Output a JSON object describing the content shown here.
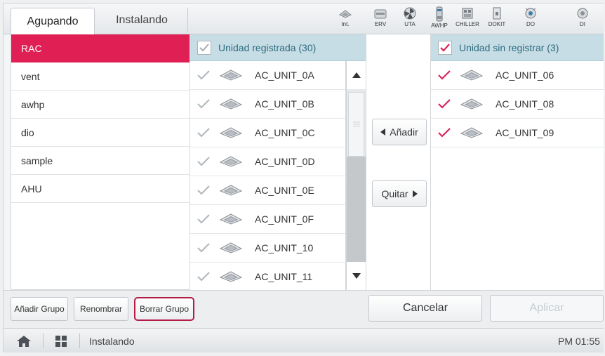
{
  "tabs": [
    {
      "label": "Agupando",
      "active": true
    },
    {
      "label": "Instalando",
      "active": false
    }
  ],
  "toolbar": [
    {
      "label": "Int.",
      "icon": "cassette-unit-icon"
    },
    {
      "label": "ERV",
      "icon": "erv-icon"
    },
    {
      "label": "UTA",
      "icon": "fan-icon"
    },
    {
      "label": "AWHP",
      "icon": "awhp-icon"
    },
    {
      "label": "CHILLER",
      "icon": "chiller-icon"
    },
    {
      "label": "DOKIT",
      "icon": "dokit-icon"
    },
    {
      "label": "DO",
      "icon": "do-icon"
    },
    {
      "label": "DI",
      "icon": "di-icon"
    }
  ],
  "groups": [
    {
      "label": "RAC",
      "selected": true
    },
    {
      "label": "vent",
      "selected": false
    },
    {
      "label": "awhp",
      "selected": false
    },
    {
      "label": "dio",
      "selected": false
    },
    {
      "label": "sample",
      "selected": false
    },
    {
      "label": "AHU",
      "selected": false
    }
  ],
  "registered": {
    "header": "Unidad registrada (30)",
    "units": [
      "AC_UNIT_0A",
      "AC_UNIT_0B",
      "AC_UNIT_0C",
      "AC_UNIT_0D",
      "AC_UNIT_0E",
      "AC_UNIT_0F",
      "AC_UNIT_10",
      "AC_UNIT_11"
    ]
  },
  "unregistered": {
    "header": "Unidad sin registrar (3)",
    "units": [
      "AC_UNIT_06",
      "AC_UNIT_08",
      "AC_UNIT_09"
    ]
  },
  "actions": {
    "add_label": "Añadir",
    "remove_label": "Quitar"
  },
  "group_buttons": {
    "add_group": "Añadir Grupo",
    "rename": "Renombrar",
    "delete_group": "Borrar Grupo"
  },
  "dialog_buttons": {
    "cancel": "Cancelar",
    "apply": "Aplicar"
  },
  "statusbar": {
    "breadcrumb": "Instalando",
    "time": "PM 01:55"
  },
  "colors": {
    "selected_group": "#e01f55",
    "check_active": "#d8245a",
    "panel_header": "#c7dde5"
  }
}
